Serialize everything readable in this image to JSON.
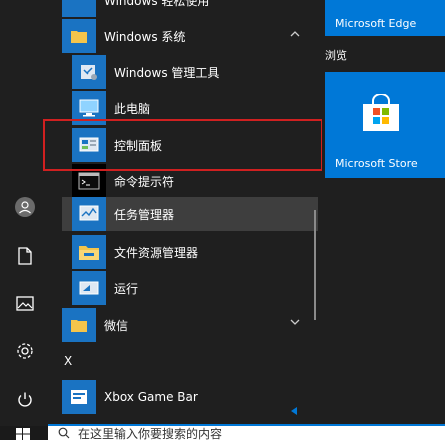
{
  "app_list": {
    "top_partial": "Windows 轻松使用",
    "folder_windows_system": "Windows 系统",
    "items": [
      {
        "label": "Windows 管理工具"
      },
      {
        "label": "此电脑"
      },
      {
        "label": "控制面板"
      },
      {
        "label": "命令提示符"
      },
      {
        "label": "任务管理器"
      },
      {
        "label": "文件资源管理器"
      },
      {
        "label": "运行"
      }
    ],
    "folder_wechat": "微信",
    "letter_x": "X",
    "xbox": "Xbox Game Bar"
  },
  "tiles": {
    "edge": "Microsoft Edge",
    "group_browse": "浏览",
    "store": "Microsoft Store"
  },
  "search": {
    "text": "在这里输入你要搜索的内容"
  },
  "colors": {
    "accent": "#0078d7",
    "highlight": "#d02020",
    "background": "#1f1f1f"
  }
}
